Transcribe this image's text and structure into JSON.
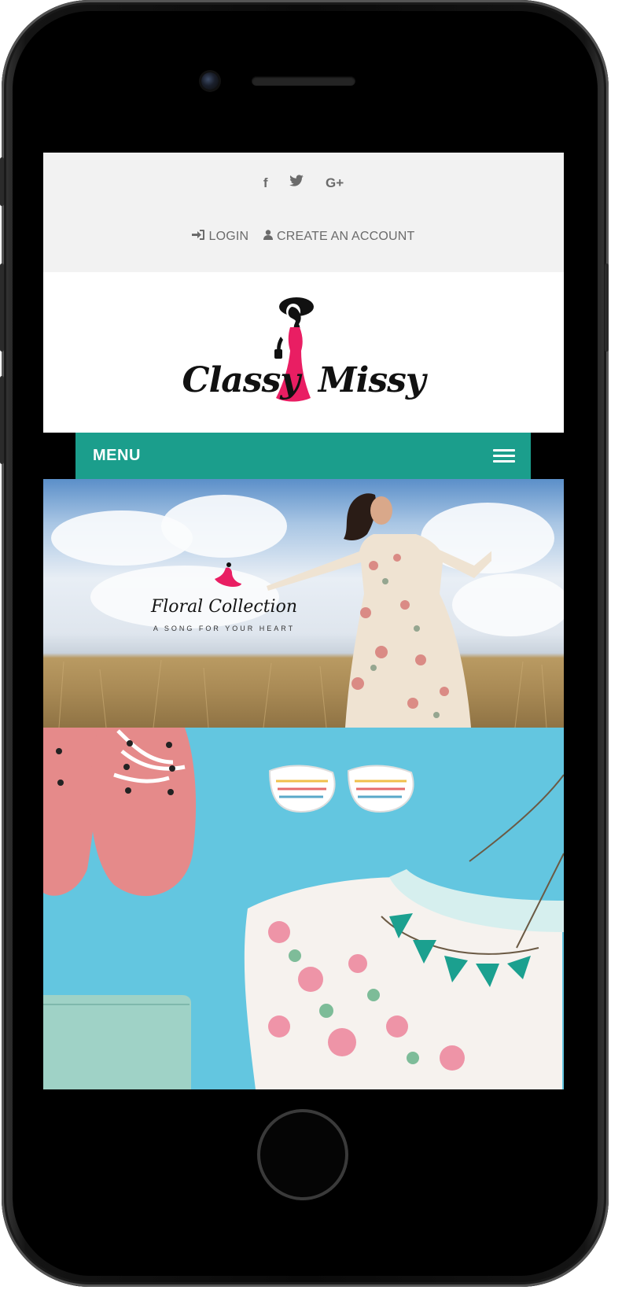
{
  "social": {
    "facebook": "f",
    "twitter": "🐦",
    "google_plus": "G+"
  },
  "auth": {
    "login_label": "LOGIN",
    "create_account_label": "CREATE AN ACCOUNT"
  },
  "logo": {
    "brand_left": "Classy",
    "brand_right": "Missy",
    "brand_color": "#e91e63"
  },
  "menu": {
    "label": "MENU",
    "bar_color": "#1b9e8c"
  },
  "slides": [
    {
      "title": "Floral Collection",
      "subtitle": "A SONG FOR YOUR HEART"
    },
    {
      "title": ""
    }
  ]
}
